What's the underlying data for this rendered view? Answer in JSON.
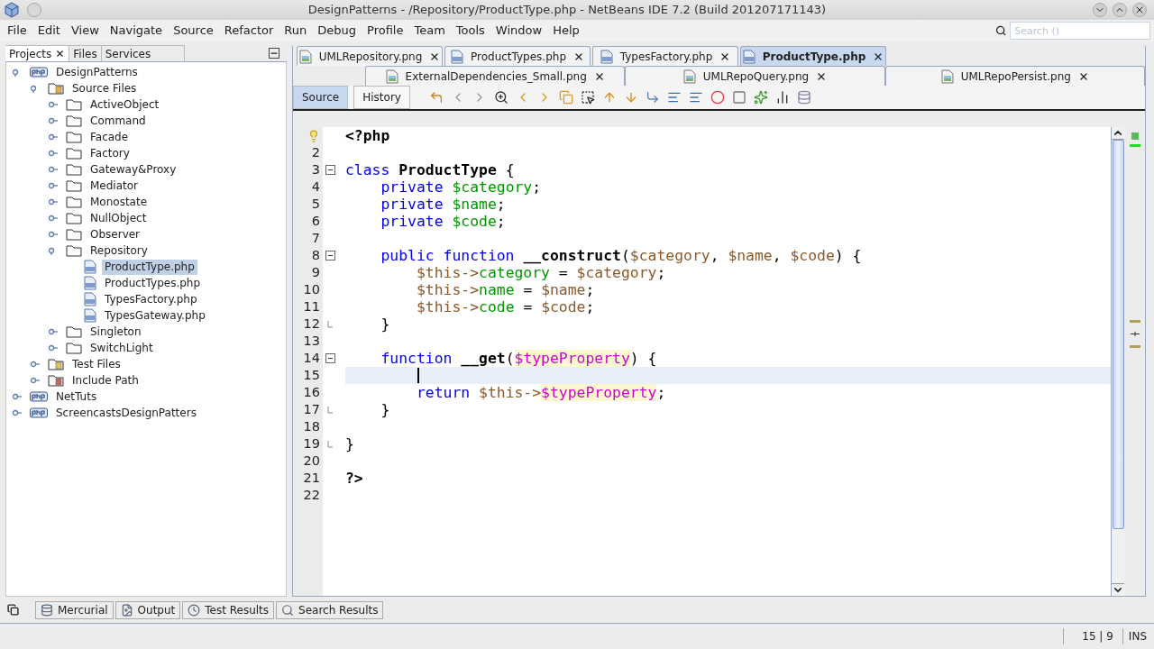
{
  "window": {
    "title": "DesignPatterns - /Repository/ProductType.php - NetBeans IDE 7.2 (Build 201207171143)"
  },
  "menu": [
    "File",
    "Edit",
    "View",
    "Navigate",
    "Source",
    "Refactor",
    "Run",
    "Debug",
    "Profile",
    "Team",
    "Tools",
    "Window",
    "Help"
  ],
  "search": {
    "placeholder": "Search ()"
  },
  "side_tabs": [
    {
      "label": "Projects",
      "selected": true,
      "closable": true
    },
    {
      "label": "Files",
      "selected": false
    },
    {
      "label": "Services",
      "selected": false
    }
  ],
  "tree": [
    {
      "label": "DesignPatterns",
      "kind": "project",
      "expanded": true,
      "selected": false,
      "children": [
        {
          "label": "Source Files",
          "kind": "source",
          "expanded": true,
          "selected": false,
          "children": [
            {
              "label": "ActiveObject",
              "kind": "folder",
              "expanded": false,
              "selected": false
            },
            {
              "label": "Command",
              "kind": "folder",
              "expanded": false,
              "selected": false
            },
            {
              "label": "Facade",
              "kind": "folder",
              "expanded": false,
              "selected": false
            },
            {
              "label": "Factory",
              "kind": "folder",
              "expanded": false,
              "selected": false
            },
            {
              "label": "Gateway&Proxy",
              "kind": "folder",
              "expanded": false,
              "selected": false
            },
            {
              "label": "Mediator",
              "kind": "folder",
              "expanded": false,
              "selected": false
            },
            {
              "label": "Monostate",
              "kind": "folder",
              "expanded": false,
              "selected": false
            },
            {
              "label": "NullObject",
              "kind": "folder",
              "expanded": false,
              "selected": false
            },
            {
              "label": "Observer",
              "kind": "folder",
              "expanded": false,
              "selected": false
            },
            {
              "label": "Repository",
              "kind": "folder",
              "expanded": true,
              "selected": false,
              "children": [
                {
                  "label": "ProductType.php",
                  "kind": "php",
                  "selected": true
                },
                {
                  "label": "ProductTypes.php",
                  "kind": "php",
                  "selected": false
                },
                {
                  "label": "TypesFactory.php",
                  "kind": "php",
                  "selected": false
                },
                {
                  "label": "TypesGateway.php",
                  "kind": "php",
                  "selected": false
                }
              ]
            },
            {
              "label": "Singleton",
              "kind": "folder",
              "expanded": false,
              "selected": false
            },
            {
              "label": "SwitchLight",
              "kind": "folder",
              "expanded": false,
              "selected": false
            }
          ]
        },
        {
          "label": "Test Files",
          "kind": "tests",
          "expanded": false,
          "selected": false
        },
        {
          "label": "Include Path",
          "kind": "include",
          "expanded": false,
          "selected": false
        }
      ]
    },
    {
      "label": "NetTuts",
      "kind": "project",
      "expanded": false,
      "selected": false
    },
    {
      "label": "ScreencastsDesignPatters",
      "kind": "project",
      "expanded": false,
      "selected": false
    }
  ],
  "editor_tabs": [
    [
      {
        "label": "UMLRepository.png",
        "kind": "image",
        "selected": false
      },
      {
        "label": "ProductTypes.php",
        "kind": "php",
        "selected": false
      },
      {
        "label": "TypesFactory.php",
        "kind": "php",
        "selected": false
      },
      {
        "label": "ProductType.php",
        "kind": "php",
        "selected": true
      }
    ],
    [
      {
        "label": "ExternalDependencies_Small.png",
        "kind": "image",
        "selected": false
      },
      {
        "label": "UMLRepoQuery.png",
        "kind": "image",
        "selected": false
      },
      {
        "label": "UMLRepoPersist.png",
        "kind": "image",
        "selected": false
      }
    ]
  ],
  "view_toggle": [
    {
      "label": "Source",
      "selected": true
    },
    {
      "label": "History",
      "selected": false
    }
  ],
  "code": [
    {
      "hint": true,
      "tokens": [
        {
          "kind": "bold",
          "text": "<?php"
        }
      ]
    },
    {
      "number": "2"
    },
    {
      "number": "3",
      "foldable": true,
      "tokens": [
        {
          "kind": "kw",
          "text": "class "
        },
        {
          "kind": "bold",
          "text": "ProductType"
        },
        {
          "kind": "plain",
          "text": " {"
        }
      ]
    },
    {
      "number": "4",
      "tokens": [
        {
          "kind": "kw",
          "text": "    private "
        },
        {
          "kind": "field",
          "text": "$category"
        },
        {
          "kind": "plain",
          "text": ";"
        }
      ]
    },
    {
      "number": "5",
      "tokens": [
        {
          "kind": "kw",
          "text": "    private "
        },
        {
          "kind": "field",
          "text": "$name"
        },
        {
          "kind": "plain",
          "text": ";"
        }
      ]
    },
    {
      "number": "6",
      "tokens": [
        {
          "kind": "kw",
          "text": "    private "
        },
        {
          "kind": "field",
          "text": "$code"
        },
        {
          "kind": "plain",
          "text": ";"
        }
      ]
    },
    {
      "number": "7"
    },
    {
      "number": "8",
      "foldable": true,
      "tokens": [
        {
          "kind": "kw",
          "text": "    public function "
        },
        {
          "kind": "bold",
          "text": "__construct"
        },
        {
          "kind": "plain",
          "text": "("
        },
        {
          "kind": "var",
          "text": "$category"
        },
        {
          "kind": "plain",
          "text": ", "
        },
        {
          "kind": "var",
          "text": "$name"
        },
        {
          "kind": "plain",
          "text": ", "
        },
        {
          "kind": "var",
          "text": "$code"
        },
        {
          "kind": "plain",
          "text": ") {"
        }
      ]
    },
    {
      "number": "9",
      "tokens": [
        {
          "kind": "var",
          "text": "        $this->"
        },
        {
          "kind": "field",
          "text": "category"
        },
        {
          "kind": "plain",
          "text": " = "
        },
        {
          "kind": "var",
          "text": "$category"
        },
        {
          "kind": "plain",
          "text": ";"
        }
      ]
    },
    {
      "number": "10",
      "tokens": [
        {
          "kind": "var",
          "text": "        $this->"
        },
        {
          "kind": "field",
          "text": "name"
        },
        {
          "kind": "plain",
          "text": " = "
        },
        {
          "kind": "var",
          "text": "$name"
        },
        {
          "kind": "plain",
          "text": ";"
        }
      ]
    },
    {
      "number": "11",
      "tokens": [
        {
          "kind": "var",
          "text": "        $this->"
        },
        {
          "kind": "field",
          "text": "code"
        },
        {
          "kind": "plain",
          "text": " = "
        },
        {
          "kind": "var",
          "text": "$code"
        },
        {
          "kind": "plain",
          "text": ";"
        }
      ]
    },
    {
      "number": "12",
      "block_end": true,
      "tokens": [
        {
          "kind": "plain",
          "text": "    }"
        }
      ]
    },
    {
      "number": "13"
    },
    {
      "number": "14",
      "foldable": true,
      "tokens": [
        {
          "kind": "kw",
          "text": "    function "
        },
        {
          "kind": "bold",
          "text": "__get"
        },
        {
          "kind": "plain",
          "text": "("
        },
        {
          "kind": "mark",
          "text": "$typeProperty"
        },
        {
          "kind": "plain",
          "text": ") {"
        }
      ]
    },
    {
      "number": "15",
      "current": true
    },
    {
      "number": "16",
      "tokens": [
        {
          "kind": "kw",
          "text": "        return "
        },
        {
          "kind": "var",
          "text": "$this->"
        },
        {
          "kind": "mark",
          "text": "$typeProperty"
        },
        {
          "kind": "plain",
          "text": ";"
        }
      ]
    },
    {
      "number": "17",
      "block_end": true,
      "tokens": [
        {
          "kind": "plain",
          "text": "    }"
        }
      ]
    },
    {
      "number": "18"
    },
    {
      "number": "19",
      "block_end": true,
      "tokens": [
        {
          "kind": "plain",
          "text": "}"
        }
      ]
    },
    {
      "number": "20"
    },
    {
      "number": "21",
      "tokens": [
        {
          "kind": "bold",
          "text": "?>"
        }
      ]
    },
    {
      "number": "22"
    }
  ],
  "bottom_tabs": [
    {
      "label": "Mercurial",
      "kind": "vcs"
    },
    {
      "label": "Output",
      "kind": "output"
    },
    {
      "label": "Test Results",
      "kind": "tests"
    },
    {
      "label": "Search Results",
      "kind": "search"
    }
  ],
  "status_bar": {
    "position": "15 | 9",
    "mode": "INS"
  }
}
